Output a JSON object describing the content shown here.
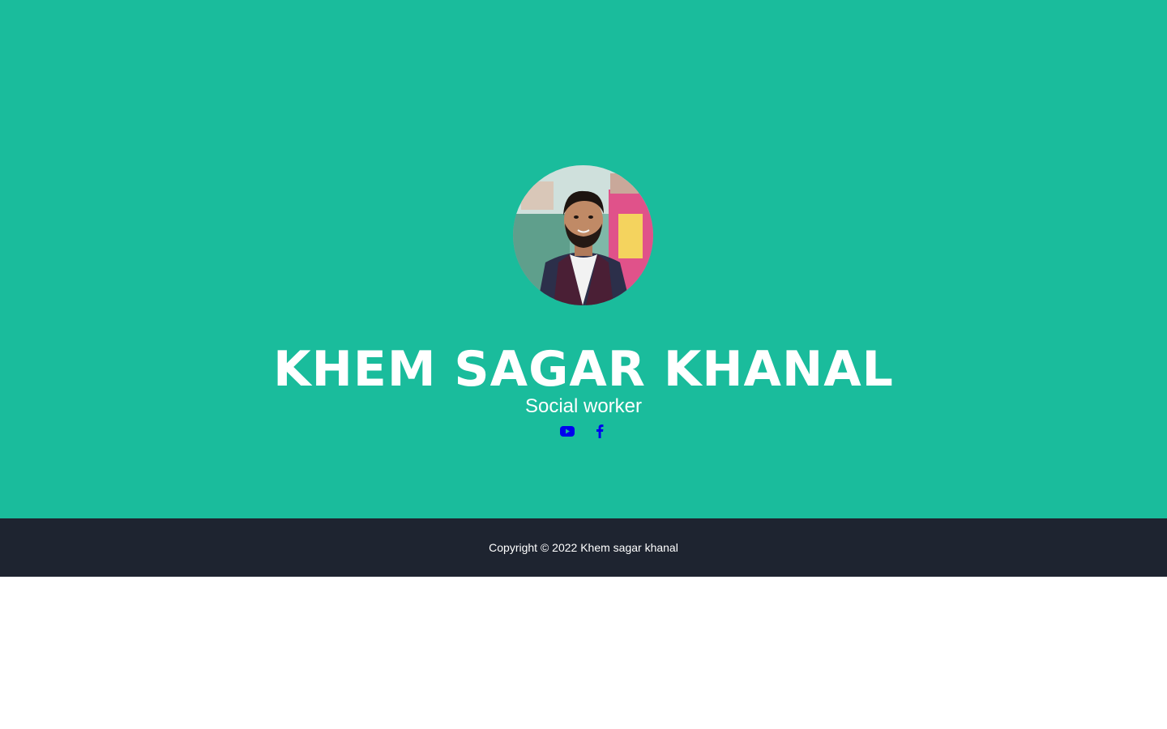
{
  "profile": {
    "name": "KHEM SAGAR KHANAL",
    "role": "Social worker",
    "photo_alt": "profile-photo"
  },
  "social": {
    "links": [
      {
        "icon": "youtube-icon",
        "color": "#0000ee"
      },
      {
        "icon": "facebook-icon",
        "color": "#0000ee"
      }
    ]
  },
  "footer": {
    "copyright": "Copyright © 2022 Khem sagar khanal"
  },
  "colors": {
    "masthead": "#1abc9c",
    "footer": "#1e2430",
    "text": "#ffffff",
    "link": "#0000ee"
  }
}
